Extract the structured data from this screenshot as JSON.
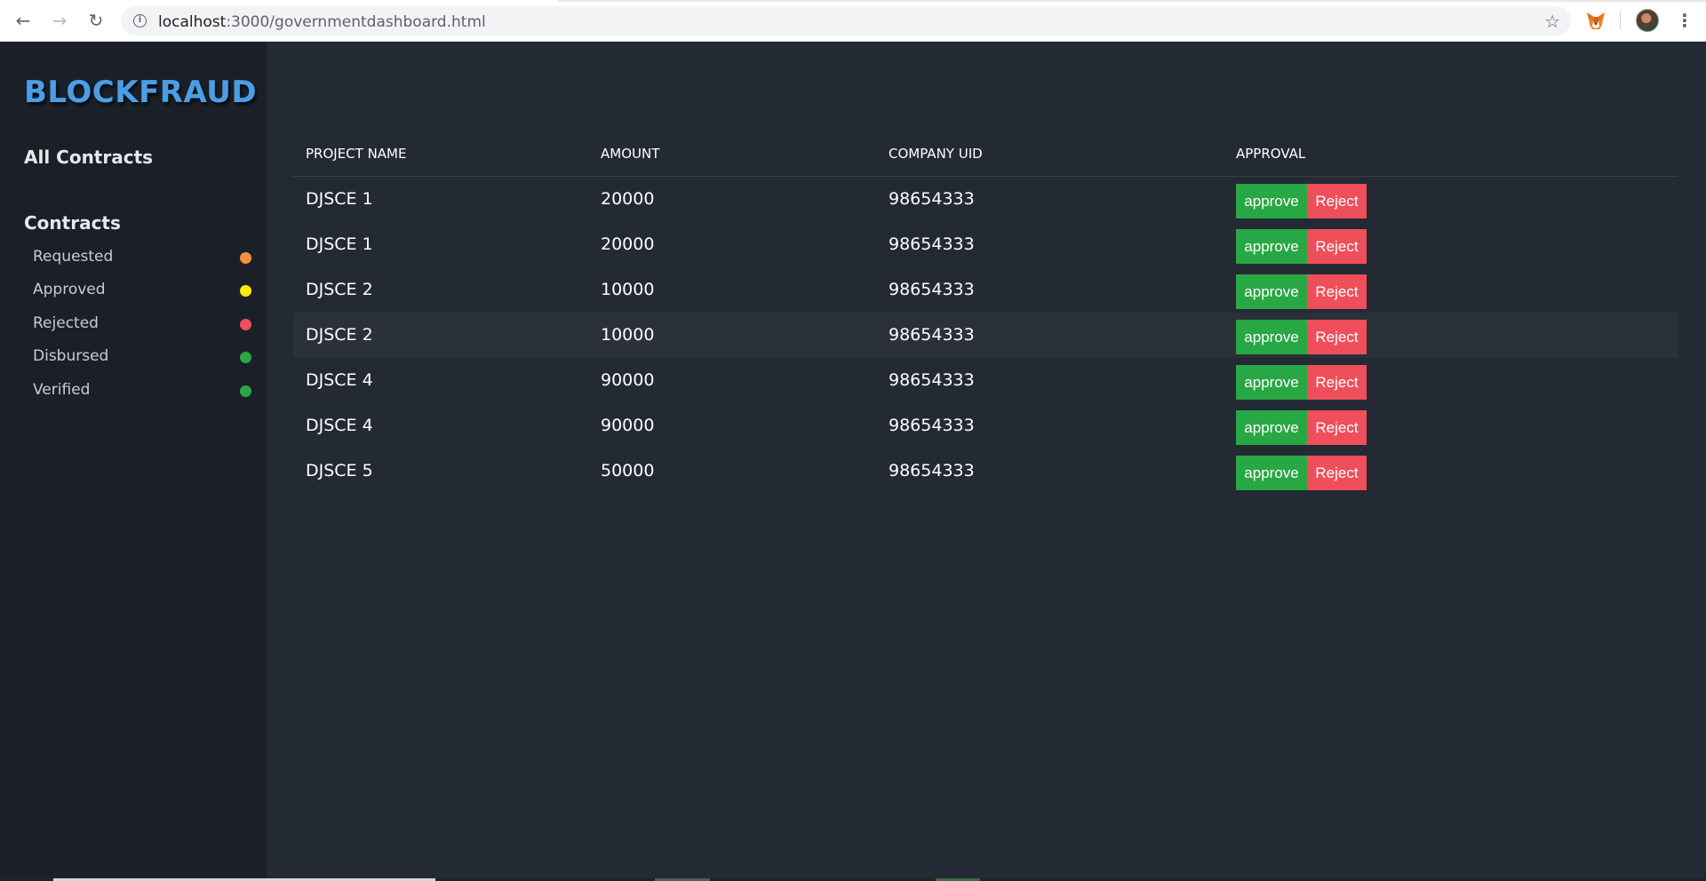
{
  "browser": {
    "back_icon": "←",
    "forward_icon": "→",
    "reload_icon": "↻",
    "info_icon": "i",
    "url_host": "localhost",
    "url_path": ":3000/governmentdashboard.html",
    "star_icon": "☆",
    "menu_icon": "⋮"
  },
  "sidebar": {
    "brand": "BLOCKFRAUD",
    "all_contracts": "All Contracts",
    "contracts_heading": "Contracts",
    "statuses": [
      {
        "label": "Requested",
        "color": "#f5923e"
      },
      {
        "label": "Approved",
        "color": "#ffea00"
      },
      {
        "label": "Rejected",
        "color": "#ef4f5a"
      },
      {
        "label": "Disbursed",
        "color": "#28a745"
      },
      {
        "label": "Verified",
        "color": "#28a745"
      }
    ]
  },
  "table": {
    "headers": [
      "PROJECT NAME",
      "AMOUNT",
      "COMPANY UID",
      "APPROVAL"
    ],
    "approve_label": "approve",
    "reject_label": "Reject",
    "rows": [
      {
        "project": "DJSCE 1",
        "amount": "20000",
        "uid": "98654333"
      },
      {
        "project": "DJSCE 1",
        "amount": "20000",
        "uid": "98654333"
      },
      {
        "project": "DJSCE 2",
        "amount": "10000",
        "uid": "98654333"
      },
      {
        "project": "DJSCE 2",
        "amount": "10000",
        "uid": "98654333"
      },
      {
        "project": "DJSCE 4",
        "amount": "90000",
        "uid": "98654333"
      },
      {
        "project": "DJSCE 4",
        "amount": "90000",
        "uid": "98654333"
      },
      {
        "project": "DJSCE 5",
        "amount": "50000",
        "uid": "98654333"
      }
    ]
  }
}
